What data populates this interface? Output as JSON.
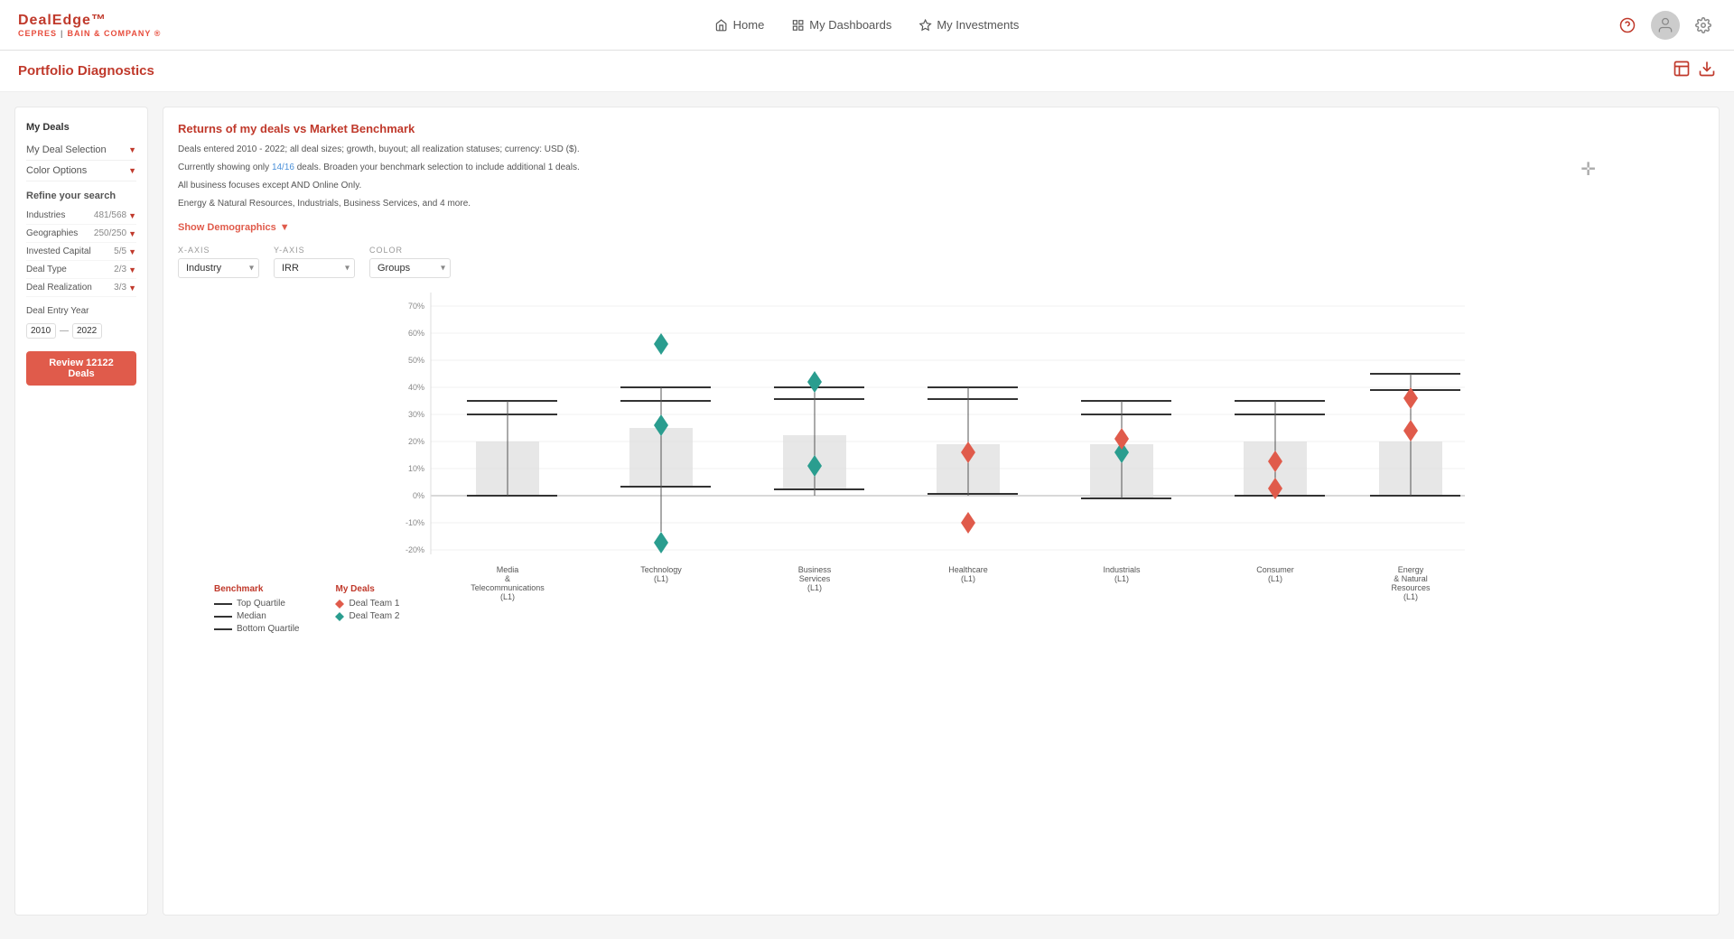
{
  "header": {
    "logo_main": "DealEdge™",
    "logo_sub_brand": "CEPRES",
    "logo_sub_company": "BAIN & COMPANY ®",
    "nav": [
      {
        "label": "Home",
        "icon": "home"
      },
      {
        "label": "My Dashboards",
        "icon": "dashboards"
      },
      {
        "label": "My Investments",
        "icon": "investments"
      }
    ]
  },
  "page": {
    "title": "Portfolio Diagnostics",
    "export_icon": "📊",
    "download_icon": "⬇"
  },
  "sidebar": {
    "my_deals_label": "My Deals",
    "deal_selection_label": "My Deal Selection",
    "color_options_label": "Color Options",
    "refine_label": "Refine your search",
    "filters": [
      {
        "label": "Industries",
        "value": "481/568",
        "has_filter": true
      },
      {
        "label": "Geographies",
        "value": "250/250",
        "has_filter": true
      },
      {
        "label": "Invested Capital",
        "value": "5/5",
        "has_filter": true
      },
      {
        "label": "Deal Type",
        "value": "2/3",
        "has_filter": true
      },
      {
        "label": "Deal Realization",
        "value": "3/3",
        "has_filter": true
      }
    ],
    "entry_year_label": "Deal Entry Year",
    "year_from": "2010",
    "year_to": "2022",
    "review_button": "Review 12122 Deals"
  },
  "chart": {
    "title": "Returns of my deals vs Market Benchmark",
    "info_lines": [
      "Deals entered 2010 - 2022; all deal sizes; growth, buyout; all realization statuses; currency: USD ($).",
      "Currently showing only 14/16 deals. Broaden your benchmark selection to include additional 1 deals.",
      "All business focuses except AND Online Only.",
      "Energy & Natural Resources, Industrials, Business Services, and 4 more."
    ],
    "show_demographics_label": "Show Demographics",
    "x_axis_label": "X-AXIS",
    "y_axis_label": "Y-AXIS",
    "color_label": "Color",
    "x_axis_value": "Industry",
    "y_axis_value": "IRR",
    "color_value": "Groups",
    "y_axis_ticks": [
      "70%",
      "60%",
      "50%",
      "40%",
      "30%",
      "20%",
      "10%",
      "0%",
      "-10%",
      "-20%"
    ],
    "groups": [
      {
        "label": "Media\n& \nTelecommunications\n(L1)",
        "label_lines": [
          "Media",
          "& ",
          "Telecommunications",
          "(L1)"
        ]
      },
      {
        "label": "Technology\n(L1)",
        "label_lines": [
          "Technology",
          "(L1)"
        ]
      },
      {
        "label": "Business\nServices\n(L1)",
        "label_lines": [
          "Business",
          "Services",
          "(L1)"
        ]
      },
      {
        "label": "Healthcare\n(L1)",
        "label_lines": [
          "Healthcare",
          "(L1)"
        ]
      },
      {
        "label": "Industrials\n(L1)",
        "label_lines": [
          "Industrials",
          "(L1)"
        ]
      },
      {
        "label": "Consumer\n(L1)",
        "label_lines": [
          "Consumer",
          "(L1)"
        ]
      },
      {
        "label": "Energy\n& Natural\nResources\n(L1)",
        "label_lines": [
          "Energy",
          "& Natural",
          "Resources",
          "(L1)"
        ]
      }
    ],
    "legend": {
      "benchmark_title": "Benchmark",
      "benchmark_items": [
        {
          "label": "Top Quartile",
          "type": "line",
          "color": "#333"
        },
        {
          "label": "Median",
          "type": "line",
          "color": "#333"
        },
        {
          "label": "Bottom Quartile",
          "type": "line",
          "color": "#333"
        }
      ],
      "my_deals_title": "My Deals",
      "my_deals_items": [
        {
          "label": "Deal Team 1",
          "type": "dot",
          "color": "#e05b4b"
        },
        {
          "label": "Deal Team 2",
          "type": "dot",
          "color": "#5b9bd5"
        }
      ]
    }
  }
}
